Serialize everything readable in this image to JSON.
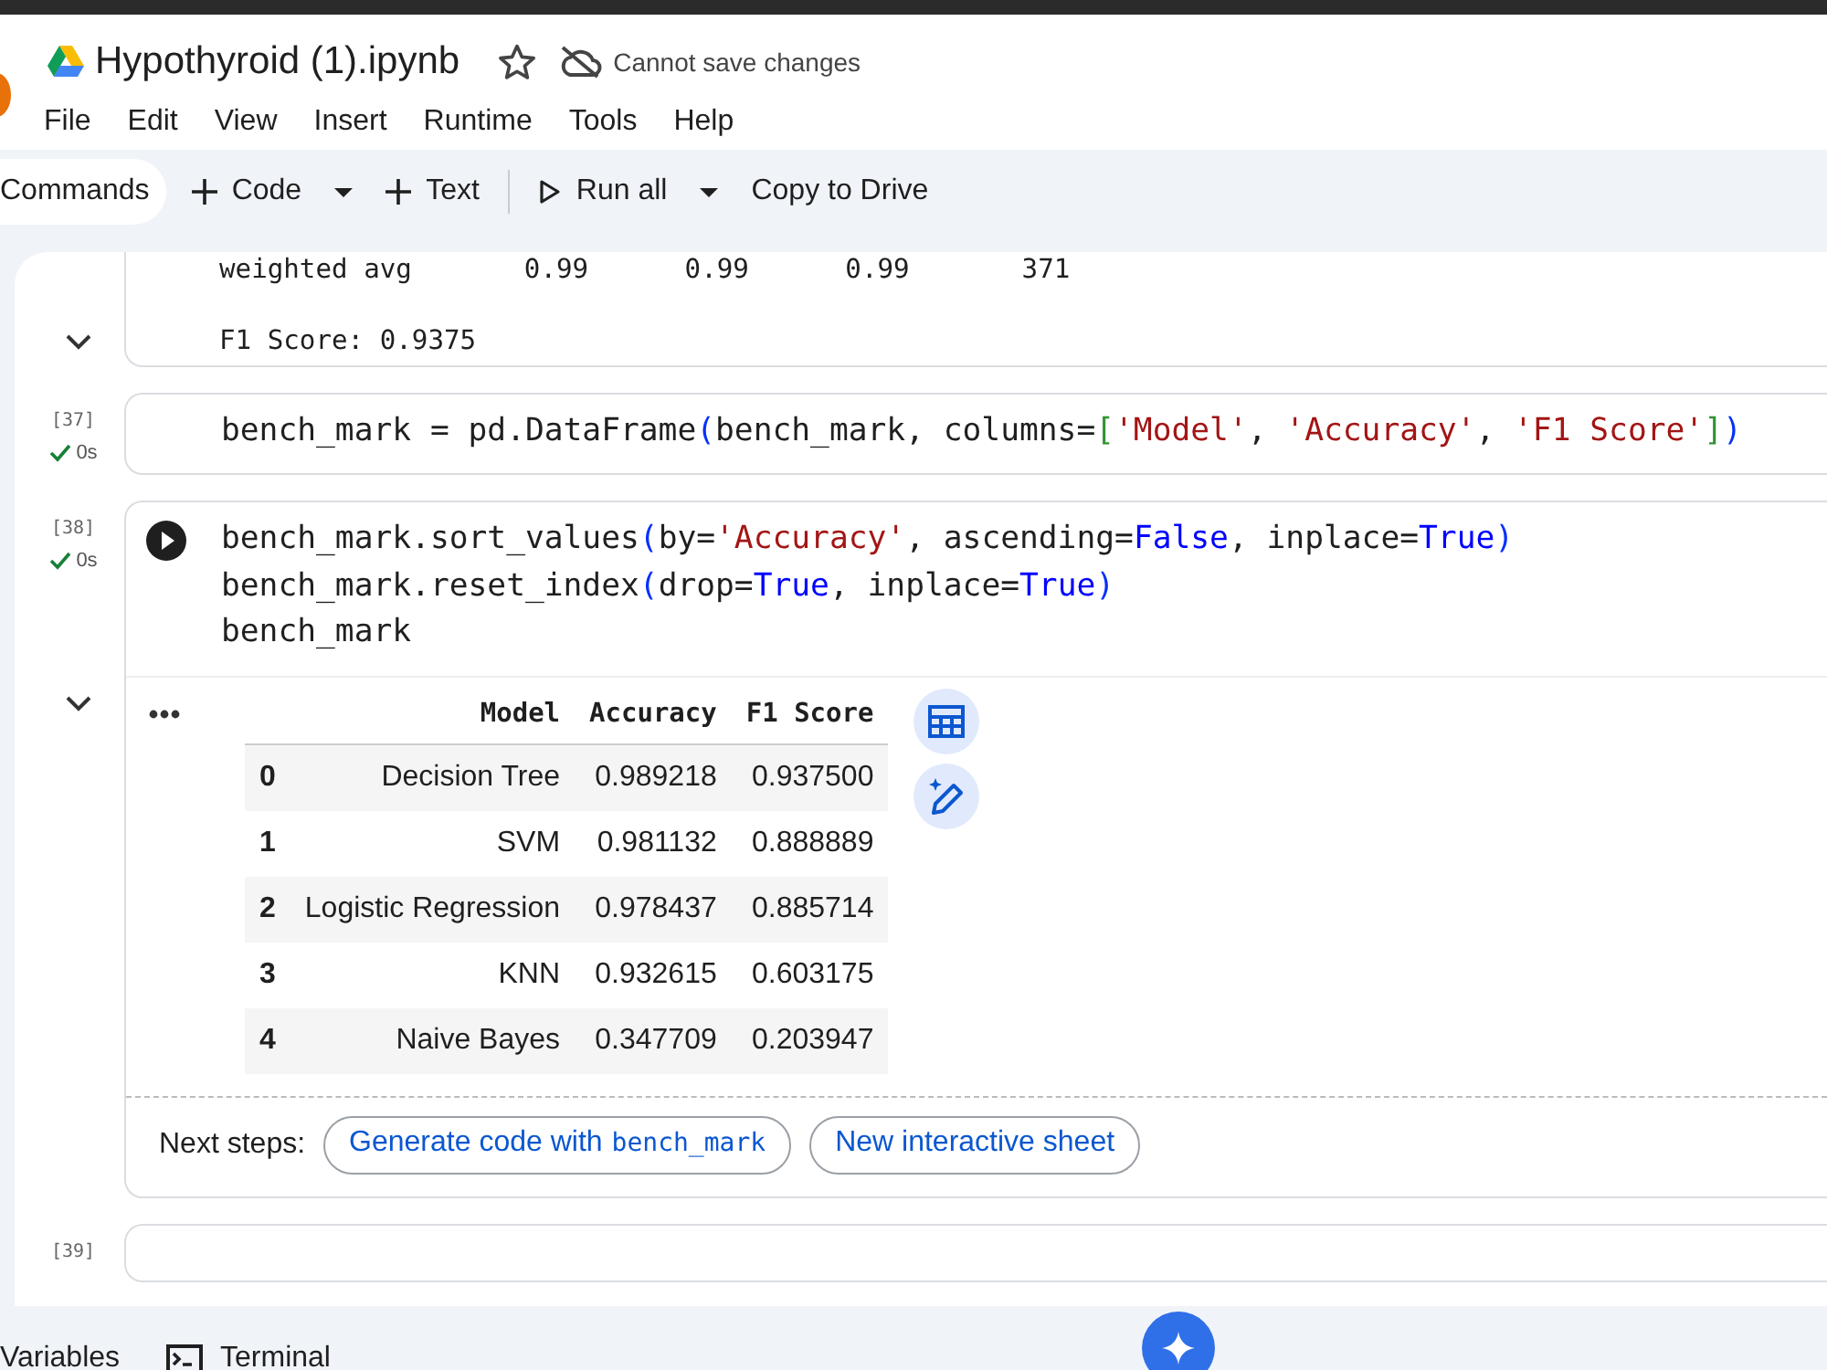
{
  "title": {
    "filename": "Hypothyroid (1).ipynb",
    "starred": false,
    "save_status": "Cannot save changes"
  },
  "menu": [
    "File",
    "Edit",
    "View",
    "Insert",
    "Runtime",
    "Tools",
    "Help"
  ],
  "toolbar": [
    {
      "kind": "pill",
      "label": "Commands"
    },
    {
      "kind": "add",
      "label": "Code"
    },
    {
      "kind": "caret"
    },
    {
      "kind": "add",
      "label": "Text"
    },
    {
      "kind": "divider"
    },
    {
      "kind": "run",
      "label": "Run all"
    },
    {
      "kind": "caret"
    },
    {
      "kind": "plain",
      "label": "Copy to Drive"
    }
  ],
  "cells": [
    {
      "output": {
        "kind": "text",
        "expanded": true,
        "blocks": [
          [
            "weighted avg       0.99      0.99      0.99       371"
          ],
          [
            "F1 Score: 0.9375"
          ]
        ]
      }
    },
    {
      "label": "[37]",
      "status": {
        "ok": true,
        "time": "0s"
      },
      "run_button": false,
      "code": [
        [
          {
            "t": "bench_mark = pd.DataFrame",
            "kind": "text"
          },
          {
            "t": "(",
            "kind": "paren"
          },
          {
            "t": "bench_mark, columns=",
            "kind": "text"
          },
          {
            "t": "[",
            "kind": "bracket"
          },
          {
            "t": "'Model'",
            "kind": "string"
          },
          {
            "t": ", ",
            "kind": "text"
          },
          {
            "t": "'Accuracy'",
            "kind": "string"
          },
          {
            "t": ", ",
            "kind": "text"
          },
          {
            "t": "'F1 Score'",
            "kind": "string"
          },
          {
            "t": "]",
            "kind": "bracket"
          },
          {
            "t": ")",
            "kind": "paren"
          }
        ]
      ]
    },
    {
      "label": "[38]",
      "status": {
        "ok": true,
        "time": "0s"
      },
      "run_button": true,
      "code": [
        [
          {
            "t": "bench_mark.sort_values",
            "kind": "text"
          },
          {
            "t": "(",
            "kind": "paren"
          },
          {
            "t": "by=",
            "kind": "text"
          },
          {
            "t": "'Accuracy'",
            "kind": "string"
          },
          {
            "t": ", ascending=",
            "kind": "text"
          },
          {
            "t": "False",
            "kind": "constant"
          },
          {
            "t": ", inplace=",
            "kind": "text"
          },
          {
            "t": "True",
            "kind": "constant"
          },
          {
            "t": ")",
            "kind": "paren"
          }
        ],
        [
          {
            "t": "bench_mark.reset_index",
            "kind": "text"
          },
          {
            "t": "(",
            "kind": "paren"
          },
          {
            "t": "drop=",
            "kind": "text"
          },
          {
            "t": "True",
            "kind": "constant"
          },
          {
            "t": ", inplace=",
            "kind": "text"
          },
          {
            "t": "True",
            "kind": "constant"
          },
          {
            "t": ")",
            "kind": "paren"
          }
        ],
        [
          {
            "t": "bench_mark",
            "kind": "text"
          }
        ]
      ],
      "output": {
        "kind": "dataframe",
        "expanded": true,
        "columns": [
          "",
          "Model",
          "Accuracy",
          "F1 Score"
        ],
        "rows": [
          [
            "0",
            "Decision Tree",
            "0.989218",
            "0.937500"
          ],
          [
            "1",
            "SVM",
            "0.981132",
            "0.888889"
          ],
          [
            "2",
            "Logistic Regression",
            "0.978437",
            "0.885714"
          ],
          [
            "3",
            "KNN",
            "0.932615",
            "0.603175"
          ],
          [
            "4",
            "Naive Bayes",
            "0.347709",
            "0.203947"
          ]
        ],
        "next_steps_label": "Next steps:",
        "next_steps": [
          {
            "label": "Generate code with",
            "code": "bench_mark"
          },
          {
            "label": "New interactive sheet"
          }
        ]
      }
    },
    {
      "label": "[39]"
    }
  ],
  "bottom_bar": [
    {
      "kind": "variables",
      "label": "Variables"
    },
    {
      "kind": "terminal",
      "label": "Terminal"
    }
  ]
}
